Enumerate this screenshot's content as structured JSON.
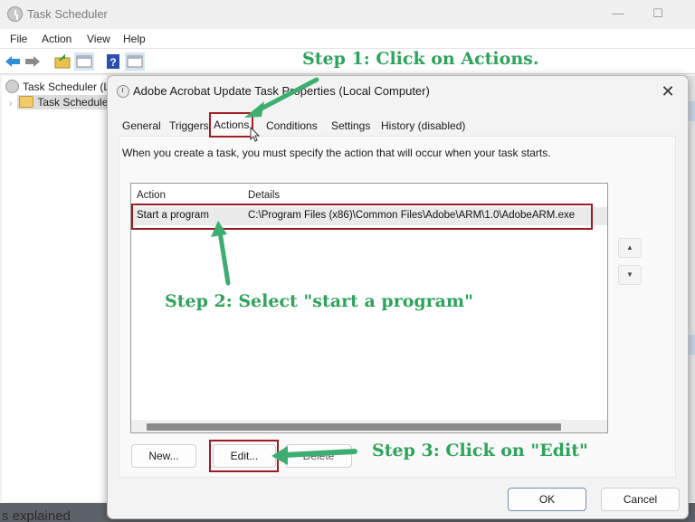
{
  "main_window": {
    "title": "Task Scheduler",
    "controls": {
      "minimize": "—",
      "maximize": "☐"
    },
    "menu": [
      "File",
      "Action",
      "View",
      "Help"
    ],
    "toolbar_icons": [
      "back-arrow-icon",
      "forward-arrow-icon",
      "folder-up-icon",
      "show-hide-console-tree-icon",
      "help-icon",
      "show-hide-action-pane-icon"
    ],
    "tree": {
      "root": "Task Scheduler (L",
      "child": "Task Schedule"
    },
    "bottom_partial_text": "s explained"
  },
  "dialog": {
    "title": "Adobe Acrobat Update Task Properties (Local Computer)",
    "close_icon": "✕",
    "tabs": [
      {
        "label": "General",
        "active": false
      },
      {
        "label": "Triggers",
        "active": false
      },
      {
        "label": "Actions",
        "active": true
      },
      {
        "label": "Conditions",
        "active": false
      },
      {
        "label": "Settings",
        "active": false
      },
      {
        "label": "History (disabled)",
        "active": false
      }
    ],
    "description": "When you create a task, you must specify the action that will occur when your task starts.",
    "list": {
      "columns": [
        "Action",
        "Details"
      ],
      "rows": [
        {
          "action": "Start a program",
          "details": "C:\\Program Files (x86)\\Common Files\\Adobe\\ARM\\1.0\\AdobeARM.exe"
        }
      ]
    },
    "move_up": "▲",
    "move_down": "▼",
    "buttons": {
      "new": "New...",
      "edit": "Edit...",
      "delete": "Delete"
    },
    "ok": "OK",
    "cancel": "Cancel"
  },
  "annotations": {
    "step1": "Step 1: Click on Actions.",
    "step2": "Step 2: Select \"start a program\"",
    "step3": "Step 3: Click on \"Edit\"",
    "color": "#2ea35b",
    "highlight_color": "#9c1c22"
  }
}
